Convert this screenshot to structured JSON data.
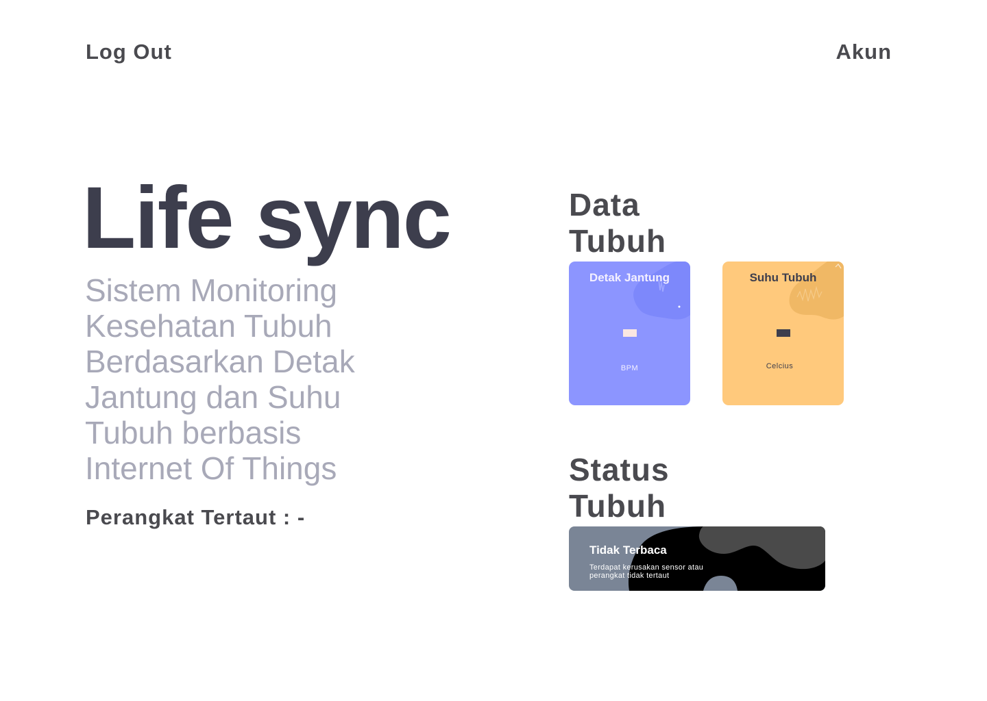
{
  "nav": {
    "logout_label": "Log Out",
    "account_label": "Akun"
  },
  "hero": {
    "title": "Life sync",
    "subtitle": "Sistem Monitoring\nKesehatan Tubuh\nBerdasarkan Detak\nJantung dan Suhu\nTubuh berbasis\nInternet Of Things",
    "device_status": "Perangkat Tertaut : -"
  },
  "body_data": {
    "section_title": "Data\nTubuh",
    "heart_card": {
      "title": "Detak Jantung",
      "unit": "BPM",
      "color": "#8c95ff"
    },
    "temp_card": {
      "title": "Suhu Tubuh",
      "unit": "Celcius",
      "color": "#ffc97c"
    }
  },
  "body_status": {
    "section_title": "Status\nTubuh",
    "status_title": "Tidak Terbaca",
    "status_description": "Terdapat kerusakan sensor atau perangkat tidak tertaut",
    "colors": {
      "card": "#7a8596",
      "blob_dark": "#000000",
      "blob_mid": "#4a4a4a"
    }
  }
}
